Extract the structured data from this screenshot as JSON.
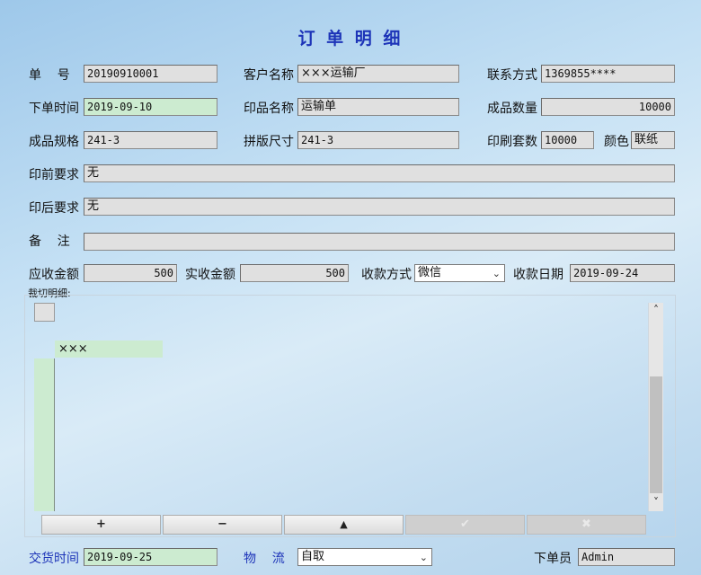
{
  "window_title": "订 单 明 细",
  "order": {
    "order_no_label": "单    号",
    "order_no": "20190910001",
    "customer_label": "客户名称",
    "customer": "×××运输厂",
    "contact_label": "联系方式",
    "contact": "1369855****",
    "order_time_label": "下单时间",
    "order_time": "2019-09-10",
    "print_name_label": "印品名称",
    "print_name": "运输单",
    "quantity_label": "成品数量",
    "quantity": "10000",
    "spec_label": "成品规格",
    "spec": "241-3",
    "layout_size_label": "拼版尺寸",
    "layout_size": "241-3",
    "sets_label": "印刷套数",
    "sets": "10000",
    "color_label": "颜色",
    "color": "联纸",
    "pre_press_label": "印前要求",
    "pre_press": "无",
    "post_press_label": "印后要求",
    "post_press": "无",
    "remark_label": "备    注",
    "remark": ""
  },
  "payment": {
    "receivable_label": "应收金额",
    "receivable": "500",
    "received_label": "实收金额",
    "received": "500",
    "method_label": "收款方式",
    "method": "微信",
    "date_label": "收款日期",
    "date": "2019-09-24"
  },
  "cutting": {
    "label": "裁切明细:",
    "header_cell": "×××"
  },
  "grid_buttons": {
    "add": "+",
    "remove": "−",
    "up": "▲",
    "confirm": "✔",
    "cancel": "✖"
  },
  "footer": {
    "delivery_label": "交货时间",
    "delivery": "2019-09-25",
    "logistics_label": "物    流",
    "logistics": "自取",
    "operator_label": "下单员",
    "operator": "Admin"
  },
  "colors": {
    "title": "#1d34b8",
    "highlight_field": "#ccebd0",
    "field": "#e0e0e0"
  }
}
